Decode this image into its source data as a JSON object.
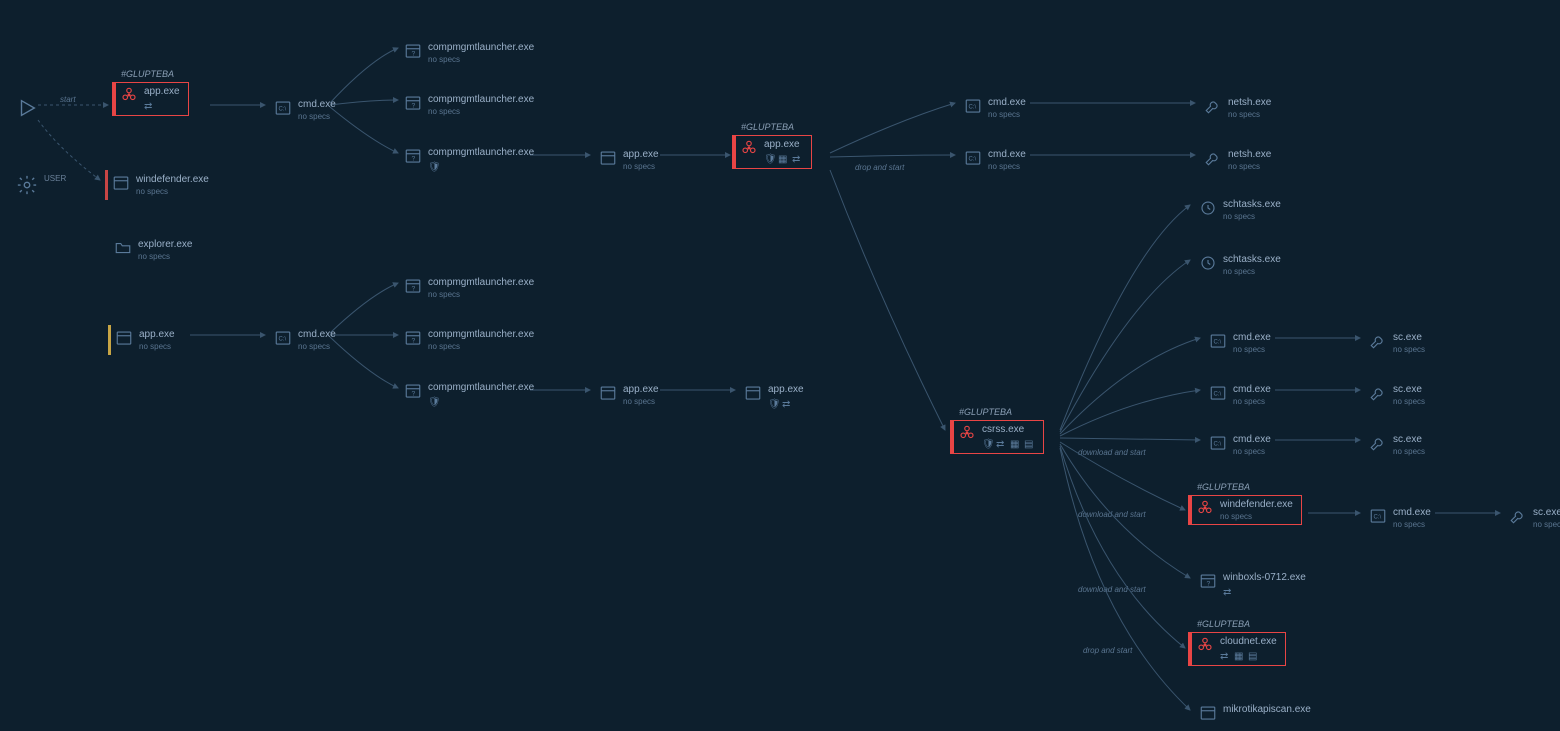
{
  "tags": {
    "glupteba": "#GLUPTEBA"
  },
  "labels": {
    "start": "start",
    "drop_and_start": "drop and start",
    "download_and_start": "download and start",
    "no_specs": "no specs"
  },
  "root": {
    "play": "play",
    "user": "USER"
  },
  "nodes": {
    "app_root": {
      "name": "app.exe"
    },
    "windefender": {
      "name": "windefender.exe"
    },
    "explorer": {
      "name": "explorer.exe"
    },
    "app2": {
      "name": "app.exe"
    },
    "cmd1": {
      "name": "cmd.exe"
    },
    "cmd2": {
      "name": "cmd.exe"
    },
    "cml1": {
      "name": "compmgmtlauncher.exe"
    },
    "cml2": {
      "name": "compmgmtlauncher.exe"
    },
    "cml3": {
      "name": "compmgmtlauncher.exe"
    },
    "cml4": {
      "name": "compmgmtlauncher.exe"
    },
    "cml5": {
      "name": "compmgmtlauncher.exe"
    },
    "cml6": {
      "name": "compmgmtlauncher.exe"
    },
    "app3": {
      "name": "app.exe"
    },
    "app4": {
      "name": "app.exe"
    },
    "app5": {
      "name": "app.exe"
    },
    "app6": {
      "name": "app.exe"
    },
    "cmd3": {
      "name": "cmd.exe"
    },
    "cmd4": {
      "name": "cmd.exe"
    },
    "netsh1": {
      "name": "netsh.exe"
    },
    "netsh2": {
      "name": "netsh.exe"
    },
    "csrss": {
      "name": "csrss.exe"
    },
    "schtasks1": {
      "name": "schtasks.exe"
    },
    "schtasks2": {
      "name": "schtasks.exe"
    },
    "cmd5": {
      "name": "cmd.exe"
    },
    "cmd6": {
      "name": "cmd.exe"
    },
    "cmd7": {
      "name": "cmd.exe"
    },
    "sc1": {
      "name": "sc.exe"
    },
    "sc2": {
      "name": "sc.exe"
    },
    "sc3": {
      "name": "sc.exe"
    },
    "windefender2": {
      "name": "windefender.exe"
    },
    "cmd8": {
      "name": "cmd.exe"
    },
    "sc4": {
      "name": "sc.exe"
    },
    "winbox": {
      "name": "winboxls-0712.exe"
    },
    "cloudnet": {
      "name": "cloudnet.exe"
    },
    "mikrotik": {
      "name": "mikrotikapiscan.exe"
    }
  }
}
